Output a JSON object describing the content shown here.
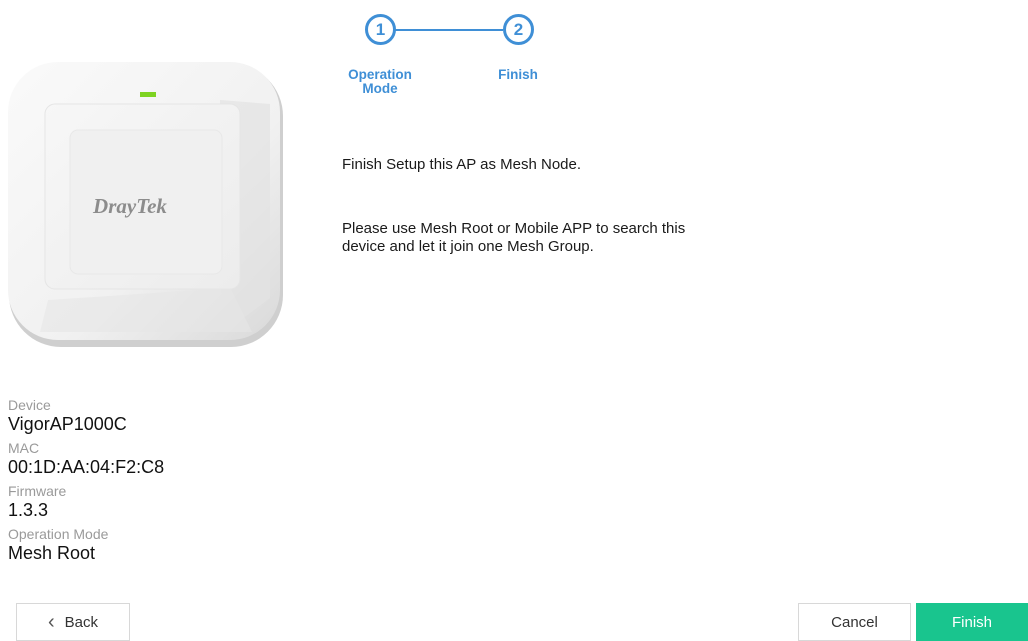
{
  "stepper": {
    "steps": [
      {
        "number": "1",
        "label_line1": "Operation",
        "label_line2": "Mode"
      },
      {
        "number": "2",
        "label_line1": "Finish",
        "label_line2": ""
      }
    ],
    "accent": "#3f8fd6"
  },
  "device_image": {
    "brand": "DrayTek",
    "led_color": "#7ed321"
  },
  "message": {
    "line1": "Finish Setup this AP as Mesh Node.",
    "para2_line1": "Please use Mesh Root or Mobile APP to search this",
    "para2_line2": "device and let it join one Mesh Group."
  },
  "info": {
    "device_label": "Device",
    "device_value": "VigorAP1000C",
    "mac_label": "MAC",
    "mac_value": "00:1D:AA:04:F2:C8",
    "firmware_label": "Firmware",
    "firmware_value": "1.3.3",
    "mode_label": "Operation Mode",
    "mode_value": "Mesh Root"
  },
  "buttons": {
    "back": "Back",
    "back_icon": "chevron-left-icon",
    "cancel": "Cancel",
    "finish": "Finish",
    "finish_color": "#19c58e"
  }
}
